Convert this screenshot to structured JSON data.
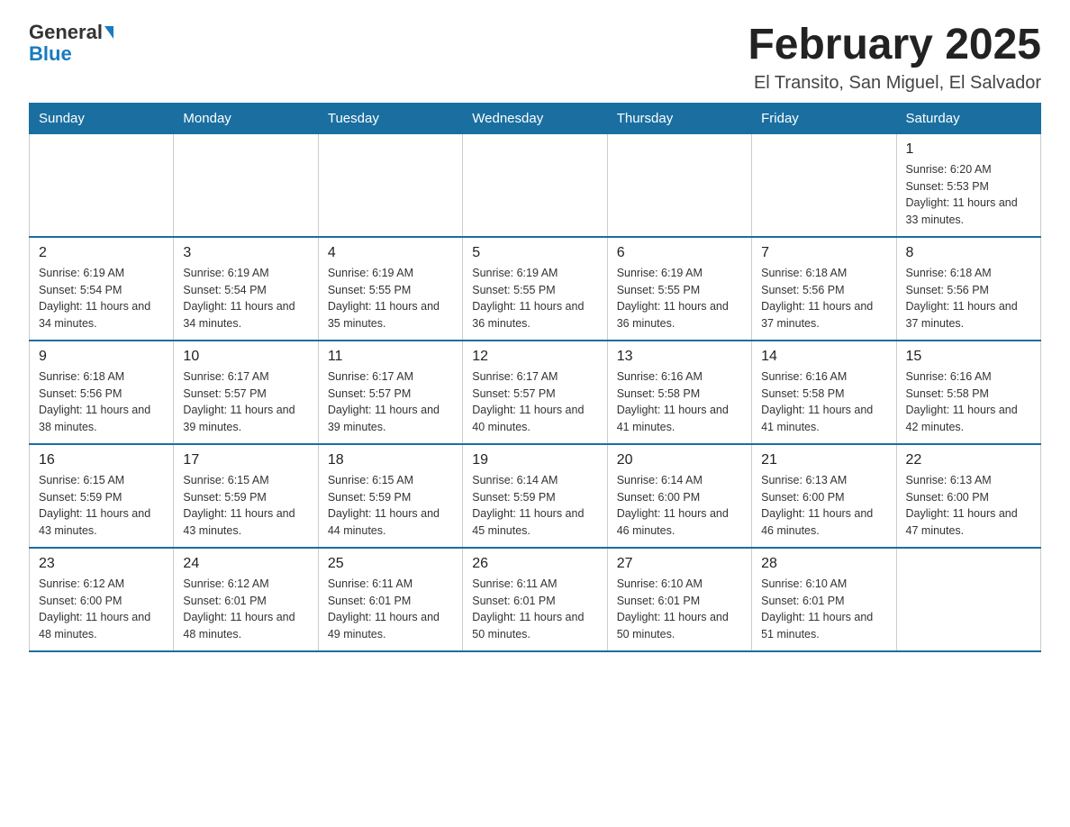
{
  "header": {
    "logo_general": "General",
    "logo_blue": "Blue",
    "title": "February 2025",
    "subtitle": "El Transito, San Miguel, El Salvador"
  },
  "calendar": {
    "days_of_week": [
      "Sunday",
      "Monday",
      "Tuesday",
      "Wednesday",
      "Thursday",
      "Friday",
      "Saturday"
    ],
    "weeks": [
      [
        {
          "day": "",
          "info": ""
        },
        {
          "day": "",
          "info": ""
        },
        {
          "day": "",
          "info": ""
        },
        {
          "day": "",
          "info": ""
        },
        {
          "day": "",
          "info": ""
        },
        {
          "day": "",
          "info": ""
        },
        {
          "day": "1",
          "info": "Sunrise: 6:20 AM\nSunset: 5:53 PM\nDaylight: 11 hours and 33 minutes."
        }
      ],
      [
        {
          "day": "2",
          "info": "Sunrise: 6:19 AM\nSunset: 5:54 PM\nDaylight: 11 hours and 34 minutes."
        },
        {
          "day": "3",
          "info": "Sunrise: 6:19 AM\nSunset: 5:54 PM\nDaylight: 11 hours and 34 minutes."
        },
        {
          "day": "4",
          "info": "Sunrise: 6:19 AM\nSunset: 5:55 PM\nDaylight: 11 hours and 35 minutes."
        },
        {
          "day": "5",
          "info": "Sunrise: 6:19 AM\nSunset: 5:55 PM\nDaylight: 11 hours and 36 minutes."
        },
        {
          "day": "6",
          "info": "Sunrise: 6:19 AM\nSunset: 5:55 PM\nDaylight: 11 hours and 36 minutes."
        },
        {
          "day": "7",
          "info": "Sunrise: 6:18 AM\nSunset: 5:56 PM\nDaylight: 11 hours and 37 minutes."
        },
        {
          "day": "8",
          "info": "Sunrise: 6:18 AM\nSunset: 5:56 PM\nDaylight: 11 hours and 37 minutes."
        }
      ],
      [
        {
          "day": "9",
          "info": "Sunrise: 6:18 AM\nSunset: 5:56 PM\nDaylight: 11 hours and 38 minutes."
        },
        {
          "day": "10",
          "info": "Sunrise: 6:17 AM\nSunset: 5:57 PM\nDaylight: 11 hours and 39 minutes."
        },
        {
          "day": "11",
          "info": "Sunrise: 6:17 AM\nSunset: 5:57 PM\nDaylight: 11 hours and 39 minutes."
        },
        {
          "day": "12",
          "info": "Sunrise: 6:17 AM\nSunset: 5:57 PM\nDaylight: 11 hours and 40 minutes."
        },
        {
          "day": "13",
          "info": "Sunrise: 6:16 AM\nSunset: 5:58 PM\nDaylight: 11 hours and 41 minutes."
        },
        {
          "day": "14",
          "info": "Sunrise: 6:16 AM\nSunset: 5:58 PM\nDaylight: 11 hours and 41 minutes."
        },
        {
          "day": "15",
          "info": "Sunrise: 6:16 AM\nSunset: 5:58 PM\nDaylight: 11 hours and 42 minutes."
        }
      ],
      [
        {
          "day": "16",
          "info": "Sunrise: 6:15 AM\nSunset: 5:59 PM\nDaylight: 11 hours and 43 minutes."
        },
        {
          "day": "17",
          "info": "Sunrise: 6:15 AM\nSunset: 5:59 PM\nDaylight: 11 hours and 43 minutes."
        },
        {
          "day": "18",
          "info": "Sunrise: 6:15 AM\nSunset: 5:59 PM\nDaylight: 11 hours and 44 minutes."
        },
        {
          "day": "19",
          "info": "Sunrise: 6:14 AM\nSunset: 5:59 PM\nDaylight: 11 hours and 45 minutes."
        },
        {
          "day": "20",
          "info": "Sunrise: 6:14 AM\nSunset: 6:00 PM\nDaylight: 11 hours and 46 minutes."
        },
        {
          "day": "21",
          "info": "Sunrise: 6:13 AM\nSunset: 6:00 PM\nDaylight: 11 hours and 46 minutes."
        },
        {
          "day": "22",
          "info": "Sunrise: 6:13 AM\nSunset: 6:00 PM\nDaylight: 11 hours and 47 minutes."
        }
      ],
      [
        {
          "day": "23",
          "info": "Sunrise: 6:12 AM\nSunset: 6:00 PM\nDaylight: 11 hours and 48 minutes."
        },
        {
          "day": "24",
          "info": "Sunrise: 6:12 AM\nSunset: 6:01 PM\nDaylight: 11 hours and 48 minutes."
        },
        {
          "day": "25",
          "info": "Sunrise: 6:11 AM\nSunset: 6:01 PM\nDaylight: 11 hours and 49 minutes."
        },
        {
          "day": "26",
          "info": "Sunrise: 6:11 AM\nSunset: 6:01 PM\nDaylight: 11 hours and 50 minutes."
        },
        {
          "day": "27",
          "info": "Sunrise: 6:10 AM\nSunset: 6:01 PM\nDaylight: 11 hours and 50 minutes."
        },
        {
          "day": "28",
          "info": "Sunrise: 6:10 AM\nSunset: 6:01 PM\nDaylight: 11 hours and 51 minutes."
        },
        {
          "day": "",
          "info": ""
        }
      ]
    ]
  }
}
